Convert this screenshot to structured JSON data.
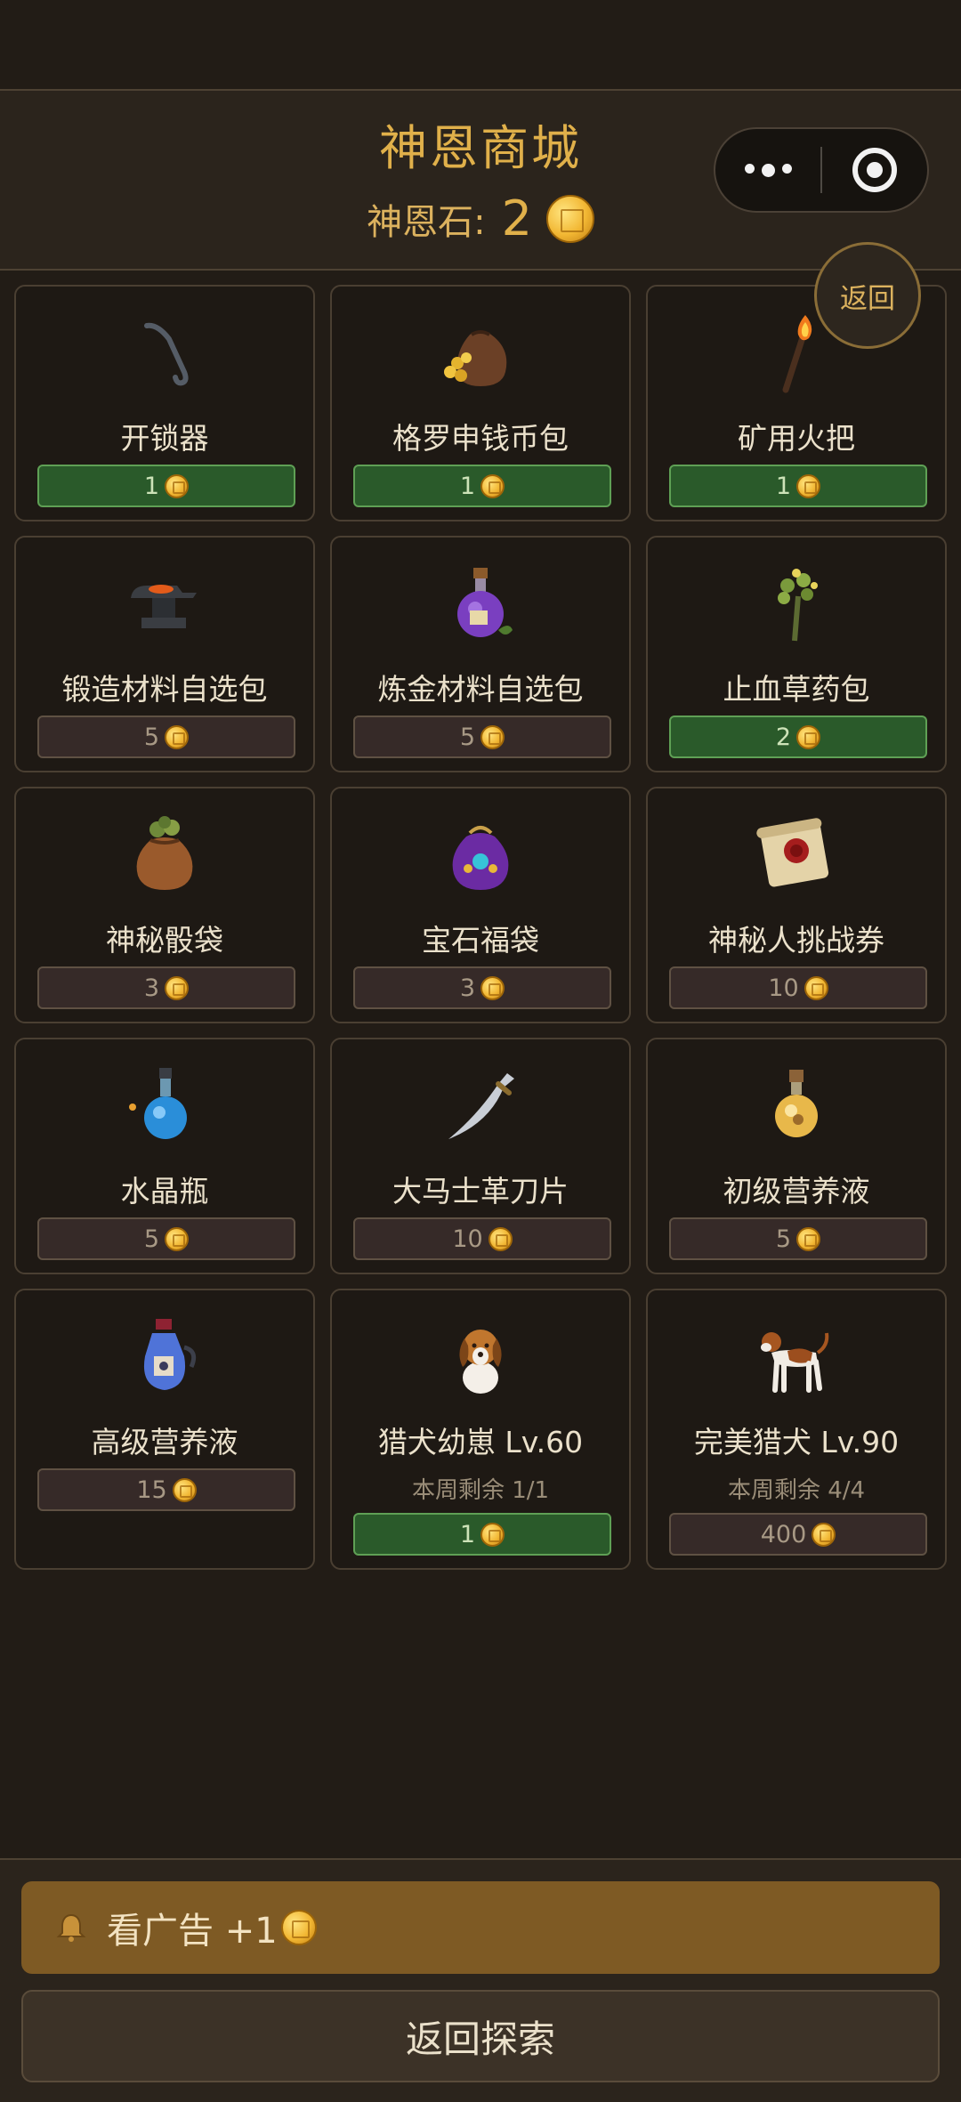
{
  "header": {
    "title": "神恩商城",
    "balance_label": "神恩石:",
    "balance_value": "2"
  },
  "floating": {
    "back_label": "返回"
  },
  "items": [
    {
      "name": "开锁器",
      "price": "1",
      "affordable": true,
      "icon": "lockpick-icon"
    },
    {
      "name": "格罗申钱币包",
      "price": "1",
      "affordable": true,
      "icon": "coin-pouch-icon"
    },
    {
      "name": "矿用火把",
      "price": "1",
      "affordable": true,
      "icon": "torch-icon"
    },
    {
      "name": "锻造材料自选包",
      "price": "5",
      "affordable": false,
      "icon": "anvil-icon"
    },
    {
      "name": "炼金材料自选包",
      "price": "5",
      "affordable": false,
      "icon": "potion-flask-icon"
    },
    {
      "name": "止血草药包",
      "price": "2",
      "affordable": true,
      "icon": "herb-bundle-icon"
    },
    {
      "name": "神秘骰袋",
      "price": "3",
      "affordable": false,
      "icon": "dice-bag-icon"
    },
    {
      "name": "宝石福袋",
      "price": "3",
      "affordable": false,
      "icon": "gem-bag-icon"
    },
    {
      "name": "神秘人挑战券",
      "price": "10",
      "affordable": false,
      "icon": "scroll-icon"
    },
    {
      "name": "水晶瓶",
      "price": "5",
      "affordable": false,
      "icon": "crystal-bottle-icon"
    },
    {
      "name": "大马士革刀片",
      "price": "10",
      "affordable": false,
      "icon": "blade-icon"
    },
    {
      "name": "初级营养液",
      "price": "5",
      "affordable": false,
      "icon": "small-nutrient-bottle-icon"
    },
    {
      "name": "高级营养液",
      "price": "15",
      "affordable": false,
      "icon": "nutrient-jug-icon"
    },
    {
      "name": "猎犬幼崽 Lv.60",
      "price": "1",
      "affordable": true,
      "quota": "本周剩余 1/1",
      "icon": "puppy-icon"
    },
    {
      "name": "完美猎犬 Lv.90",
      "price": "400",
      "affordable": false,
      "quota": "本周剩余 4/4",
      "icon": "hound-icon"
    }
  ],
  "bottom": {
    "ad_label": "看广告 +1",
    "explore_label": "返回探索"
  },
  "colors": {
    "background": "#221c16",
    "gold": "#e0b04a",
    "afford_green": "#2a5a2a",
    "ad_button": "#7e5a24"
  }
}
